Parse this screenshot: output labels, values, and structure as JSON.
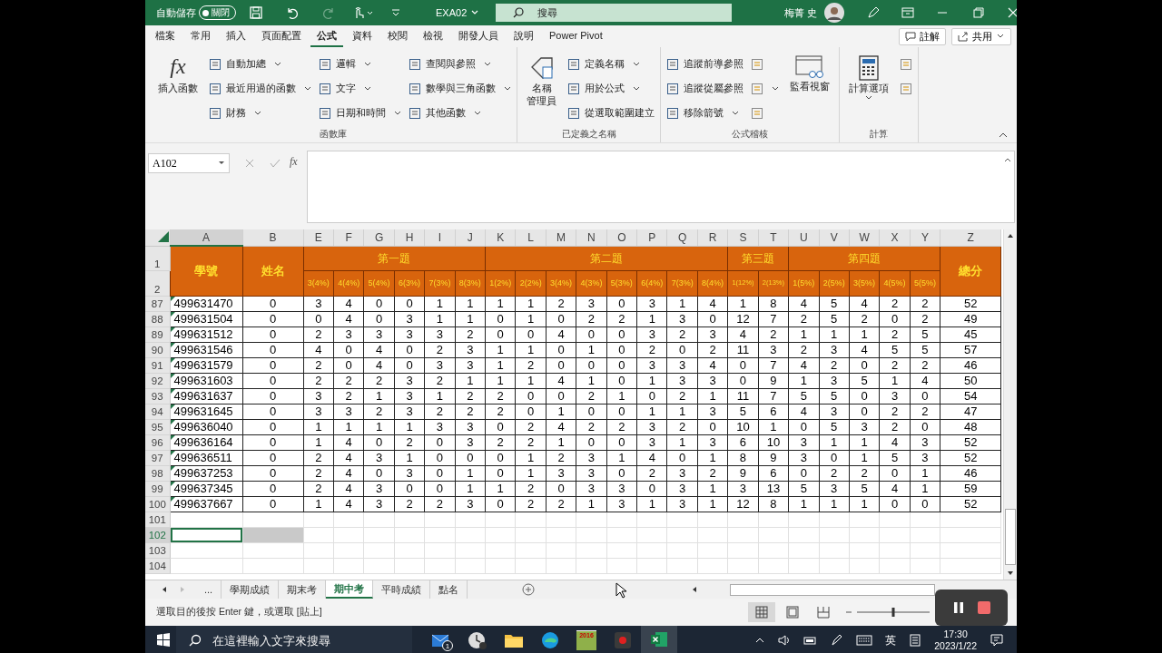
{
  "title_bar": {
    "autosave_label": "自動儲存",
    "autosave": {
      "text": "關閉",
      "on": false
    },
    "file_name": "EXA02",
    "search_placeholder": "搜尋",
    "user_name": "梅菁 史"
  },
  "menu_tabs": [
    {
      "label": "檔案",
      "selected": false
    },
    {
      "label": "常用",
      "selected": false
    },
    {
      "label": "插入",
      "selected": false
    },
    {
      "label": "頁面配置",
      "selected": false
    },
    {
      "label": "公式",
      "selected": true
    },
    {
      "label": "資料",
      "selected": false
    },
    {
      "label": "校閱",
      "selected": false
    },
    {
      "label": "檢視",
      "selected": false
    },
    {
      "label": "開發人員",
      "selected": false
    },
    {
      "label": "說明",
      "selected": false
    },
    {
      "label": "Power Pivot",
      "selected": false
    }
  ],
  "comment_button": "註解",
  "share_button": "共用",
  "ribbon": {
    "groups": [
      {
        "label": "函數庫",
        "large": [
          {
            "kind": "fx",
            "icon_text": "fx",
            "lines": [
              "插入函數"
            ]
          }
        ],
        "columns": [
          [
            {
              "label": "自動加總",
              "dropdown": true
            },
            {
              "label": "最近用過的函數",
              "dropdown": true
            },
            {
              "label": "財務",
              "dropdown": true
            }
          ],
          [
            {
              "label": "邏輯",
              "dropdown": true
            },
            {
              "label": "文字",
              "dropdown": true
            },
            {
              "label": "日期和時間",
              "dropdown": true
            }
          ],
          [
            {
              "label": "查閱與參照",
              "dropdown": true
            },
            {
              "label": "數學與三角函數",
              "dropdown": true
            },
            {
              "label": "其他函數",
              "dropdown": true
            }
          ]
        ]
      },
      {
        "label": "已定義之名稱",
        "large": [
          {
            "kind": "tag",
            "lines": [
              "名稱",
              "管理員"
            ]
          }
        ],
        "columns": [
          [
            {
              "label": "定義名稱",
              "dropdown": true
            },
            {
              "label": "用於公式",
              "dropdown": true
            },
            {
              "label": "從選取範圍建立",
              "dropdown": false
            }
          ]
        ]
      },
      {
        "label": "公式稽核",
        "columns": [
          [
            {
              "label": "追蹤前導參照",
              "dropdown": false
            },
            {
              "label": "追蹤從屬參照",
              "dropdown": false
            },
            {
              "label": "移除箭號",
              "dropdown": true
            }
          ],
          [
            {
              "dropdown": false
            },
            {
              "dropdown": true
            },
            {
              "dropdown": false
            }
          ]
        ],
        "after": [
          {
            "kind": "watch",
            "lines": [
              "監看視窗"
            ]
          }
        ]
      },
      {
        "label": "計算",
        "large": [
          {
            "kind": "calc",
            "lines": [
              "計算選項"
            ]
          }
        ],
        "columns": [
          [
            {
              "dropdown": false
            },
            {
              "dropdown": false
            }
          ]
        ]
      }
    ]
  },
  "formula_bar": {
    "name_box": "A102",
    "fx": "fx"
  },
  "sheet": {
    "column_letters": [
      "A",
      "B",
      "E",
      "F",
      "G",
      "H",
      "I",
      "J",
      "K",
      "L",
      "M",
      "N",
      "O",
      "P",
      "Q",
      "R",
      "S",
      "T",
      "U",
      "V",
      "W",
      "X",
      "Y",
      "Z"
    ],
    "row_numbers_header": [
      "1",
      "2"
    ],
    "id_header": "學號",
    "name_header": "姓名",
    "total_header": "總分",
    "groups": [
      {
        "label": "第一題",
        "subheaders": [
          "3(4%)",
          "4(4%)",
          "5(4%)",
          "6(3%)",
          "7(3%)",
          "8(3%)"
        ]
      },
      {
        "label": "第二題",
        "subheaders": [
          "1(2%)",
          "2(2%)",
          "3(4%)",
          "4(3%)",
          "5(3%)",
          "6(4%)",
          "7(3%)",
          "8(4%)"
        ]
      },
      {
        "label": "第三題",
        "subheaders": [
          "1(12%)",
          "2(13%)"
        ]
      },
      {
        "label": "第四題",
        "subheaders": [
          "1(5%)",
          "2(5%)",
          "3(5%)",
          "4(5%)",
          "5(5%)"
        ]
      }
    ],
    "rows": [
      {
        "num": "87",
        "id": "499631470",
        "name": "0",
        "scores": [
          "3",
          "4",
          "0",
          "0",
          "1",
          "1",
          "1",
          "1",
          "2",
          "3",
          "0",
          "3",
          "1",
          "4",
          "1",
          "8",
          "4",
          "5",
          "4",
          "2",
          "2"
        ],
        "total": "52"
      },
      {
        "num": "88",
        "id": "499631504",
        "name": "0",
        "scores": [
          "0",
          "4",
          "0",
          "3",
          "1",
          "1",
          "0",
          "1",
          "0",
          "2",
          "2",
          "1",
          "3",
          "0",
          "12",
          "7",
          "2",
          "5",
          "2",
          "0",
          "2"
        ],
        "total": "49"
      },
      {
        "num": "89",
        "id": "499631512",
        "name": "0",
        "scores": [
          "2",
          "3",
          "3",
          "3",
          "3",
          "2",
          "0",
          "0",
          "4",
          "0",
          "0",
          "3",
          "2",
          "3",
          "4",
          "2",
          "1",
          "1",
          "1",
          "2",
          "5"
        ],
        "total": "45"
      },
      {
        "num": "90",
        "id": "499631546",
        "name": "0",
        "scores": [
          "4",
          "0",
          "4",
          "0",
          "2",
          "3",
          "1",
          "1",
          "0",
          "1",
          "0",
          "2",
          "0",
          "2",
          "11",
          "3",
          "2",
          "3",
          "4",
          "5",
          "5"
        ],
        "total": "57"
      },
      {
        "num": "91",
        "id": "499631579",
        "name": "0",
        "scores": [
          "2",
          "0",
          "4",
          "0",
          "3",
          "3",
          "1",
          "2",
          "0",
          "0",
          "0",
          "3",
          "3",
          "4",
          "0",
          "7",
          "4",
          "2",
          "0",
          "2",
          "2"
        ],
        "total": "46"
      },
      {
        "num": "92",
        "id": "499631603",
        "name": "0",
        "scores": [
          "2",
          "2",
          "2",
          "3",
          "2",
          "1",
          "1",
          "1",
          "4",
          "1",
          "0",
          "1",
          "3",
          "3",
          "0",
          "9",
          "1",
          "3",
          "5",
          "1",
          "4"
        ],
        "total": "50"
      },
      {
        "num": "93",
        "id": "499631637",
        "name": "0",
        "scores": [
          "3",
          "2",
          "1",
          "3",
          "1",
          "2",
          "2",
          "0",
          "0",
          "2",
          "1",
          "0",
          "2",
          "1",
          "11",
          "7",
          "5",
          "5",
          "0",
          "3",
          "0"
        ],
        "total": "54"
      },
      {
        "num": "94",
        "id": "499631645",
        "name": "0",
        "scores": [
          "3",
          "3",
          "2",
          "3",
          "2",
          "2",
          "2",
          "0",
          "1",
          "0",
          "0",
          "1",
          "1",
          "3",
          "5",
          "6",
          "4",
          "3",
          "0",
          "2",
          "2"
        ],
        "total": "47"
      },
      {
        "num": "95",
        "id": "499636040",
        "name": "0",
        "scores": [
          "1",
          "1",
          "1",
          "1",
          "3",
          "3",
          "0",
          "2",
          "4",
          "2",
          "2",
          "3",
          "2",
          "0",
          "10",
          "1",
          "0",
          "5",
          "3",
          "2",
          "0"
        ],
        "total": "48"
      },
      {
        "num": "96",
        "id": "499636164",
        "name": "0",
        "scores": [
          "1",
          "4",
          "0",
          "2",
          "0",
          "3",
          "2",
          "2",
          "1",
          "0",
          "0",
          "3",
          "1",
          "3",
          "6",
          "10",
          "3",
          "1",
          "1",
          "4",
          "3"
        ],
        "total": "52"
      },
      {
        "num": "97",
        "id": "499636511",
        "name": "0",
        "scores": [
          "2",
          "4",
          "3",
          "1",
          "0",
          "0",
          "0",
          "1",
          "2",
          "3",
          "1",
          "4",
          "0",
          "1",
          "8",
          "9",
          "3",
          "0",
          "1",
          "5",
          "3"
        ],
        "total": "52"
      },
      {
        "num": "98",
        "id": "499637253",
        "name": "0",
        "scores": [
          "2",
          "4",
          "0",
          "3",
          "0",
          "1",
          "0",
          "1",
          "3",
          "3",
          "0",
          "2",
          "3",
          "2",
          "9",
          "6",
          "0",
          "2",
          "2",
          "0",
          "1"
        ],
        "total": "46"
      },
      {
        "num": "99",
        "id": "499637345",
        "name": "0",
        "scores": [
          "2",
          "4",
          "3",
          "0",
          "0",
          "1",
          "1",
          "2",
          "0",
          "3",
          "3",
          "0",
          "3",
          "1",
          "3",
          "13",
          "5",
          "3",
          "5",
          "4",
          "1"
        ],
        "total": "59"
      },
      {
        "num": "100",
        "id": "499637667",
        "name": "0",
        "scores": [
          "1",
          "4",
          "3",
          "2",
          "2",
          "3",
          "0",
          "2",
          "2",
          "1",
          "3",
          "1",
          "3",
          "1",
          "12",
          "8",
          "1",
          "1",
          "1",
          "0",
          "0"
        ],
        "total": "52"
      }
    ],
    "empty_rows": [
      {
        "num": "101",
        "selected": false
      },
      {
        "num": "102",
        "selected": true
      },
      {
        "num": "103",
        "selected": false
      },
      {
        "num": "104",
        "selected": false
      }
    ]
  },
  "sheet_tabs": [
    {
      "label": "...",
      "selected": false
    },
    {
      "label": "學期成績",
      "selected": false
    },
    {
      "label": "期末考",
      "selected": false
    },
    {
      "label": "期中考",
      "selected": true
    },
    {
      "label": "平時成績",
      "selected": false
    },
    {
      "label": "點名",
      "selected": false
    }
  ],
  "status_bar": {
    "text": "選取目的後按 Enter 鍵，或選取 [貼上]",
    "zoom": {
      "level": 0.5
    }
  },
  "taskbar": {
    "search_placeholder": "在這裡輸入文字來搜尋",
    "apps": [
      {
        "kind": "mail",
        "badge": "1",
        "active": false
      },
      {
        "kind": "clock",
        "active": false
      },
      {
        "kind": "folder",
        "active": false
      },
      {
        "kind": "edge",
        "active": false
      },
      {
        "kind": "app2016",
        "text": "2016",
        "active": false
      },
      {
        "kind": "recorder",
        "active": false
      },
      {
        "kind": "excel",
        "active": true
      }
    ],
    "ime": "英",
    "time": "17:30",
    "date": "2023/1/22"
  }
}
